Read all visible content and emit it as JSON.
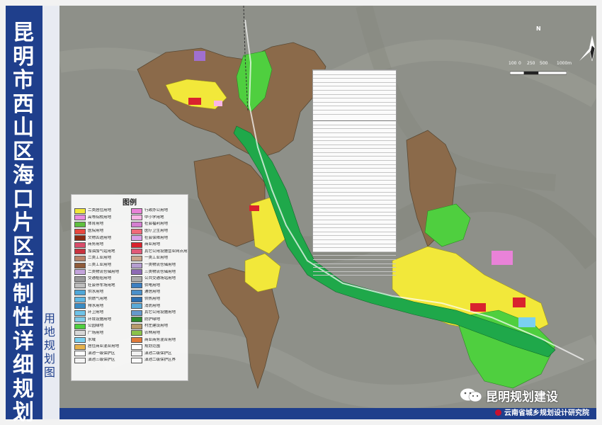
{
  "title": "昆明市西山区海口片区控制性详细规划",
  "subtitle": "用地规划图",
  "watermark": "昆明规划建设",
  "institute": "云南省城乡规划设计研究院",
  "north_label": "N",
  "scale_labels": [
    "100",
    "0",
    "250",
    "500",
    "1000m"
  ],
  "legend": {
    "title": "图例",
    "left": [
      {
        "label": "二类居住用地",
        "color": "#f2e83a"
      },
      {
        "label": "高等院校用地",
        "color": "#e98be0"
      },
      {
        "label": "体育用地",
        "color": "#5fbf3f"
      },
      {
        "label": "医院用地",
        "color": "#e8483f"
      },
      {
        "label": "文物古迹用地",
        "color": "#8a2a12"
      },
      {
        "label": "商务用地",
        "color": "#d94c6a"
      },
      {
        "label": "加油加气站用地",
        "color": "#c8323e"
      },
      {
        "label": "二类工业用地",
        "color": "#b9836a"
      },
      {
        "label": "三类工业用地",
        "color": "#8f5b3a"
      },
      {
        "label": "二类物流仓储用地",
        "color": "#c4a4dc"
      },
      {
        "label": "交通枢纽用地",
        "color": "#9a9a9a"
      },
      {
        "label": "社会停车场用地",
        "color": "#bdbdbd"
      },
      {
        "label": "供水用地",
        "color": "#4fa7d8"
      },
      {
        "label": "供燃气用地",
        "color": "#5fb8e4"
      },
      {
        "label": "排水用地",
        "color": "#3a8cc4"
      },
      {
        "label": "环卫用地",
        "color": "#6ec3e8"
      },
      {
        "label": "环境设施用地",
        "color": "#7fcbe9"
      },
      {
        "label": "公园绿地",
        "color": "#4fcf3f"
      },
      {
        "label": "广场用地",
        "color": "#d8d8d8"
      },
      {
        "label": "水域",
        "color": "#7ad0f0"
      },
      {
        "label": "居住商业混合用地",
        "color": "#e6b24c"
      },
      {
        "label": "滇池一级保护区",
        "color": "#ffffff"
      },
      {
        "label": "滇池三级保护区",
        "color": "#f4f4f4"
      }
    ],
    "right": [
      {
        "label": "行政办公用地",
        "color": "#e982d8"
      },
      {
        "label": "中小学用地",
        "color": "#f9b6e6"
      },
      {
        "label": "社会福利用地",
        "color": "#d47fd0"
      },
      {
        "label": "医疗卫生用地",
        "color": "#f06a7a"
      },
      {
        "label": "社会保障用地",
        "color": "#d8a0e8"
      },
      {
        "label": "商业用地",
        "color": "#d9232e"
      },
      {
        "label": "其它公用设施营业网点用地",
        "color": "#e05a78"
      },
      {
        "label": "一类工业用地",
        "color": "#c9a48a"
      },
      {
        "label": "一类物流仓储用地",
        "color": "#b59ed0"
      },
      {
        "label": "三类物流仓储用地",
        "color": "#8e6ab5"
      },
      {
        "label": "公共交通场站用地",
        "color": "#aaaaaa"
      },
      {
        "label": "供电用地",
        "color": "#3d7fc1"
      },
      {
        "label": "通信用地",
        "color": "#4b90c9"
      },
      {
        "label": "供热用地",
        "color": "#2c6fb0"
      },
      {
        "label": "消防用地",
        "color": "#5aaad8"
      },
      {
        "label": "其它公用设施用地",
        "color": "#6699cc"
      },
      {
        "label": "防护绿地",
        "color": "#2e8b2e"
      },
      {
        "label": "村庄建设用地",
        "color": "#b79a6a"
      },
      {
        "label": "农林用地",
        "color": "#8bc34a"
      },
      {
        "label": "商业商务混合用地",
        "color": "#e07a3a"
      },
      {
        "label": "规划范围",
        "color": "#ffffff"
      },
      {
        "label": "滇池二级保护区",
        "color": "#f0f0f0"
      },
      {
        "label": "滇池二级保护区界",
        "color": "#fafafa"
      }
    ]
  },
  "colors": {
    "frame_blue": "#1f3f8c",
    "terrain": "#8e9089",
    "residential": "#f2e83a",
    "village": "#8b6a4a",
    "green": "#4fcf3f",
    "road_green": "#1fa84a",
    "commercial": "#d9232e",
    "water": "#7ad0f0"
  }
}
